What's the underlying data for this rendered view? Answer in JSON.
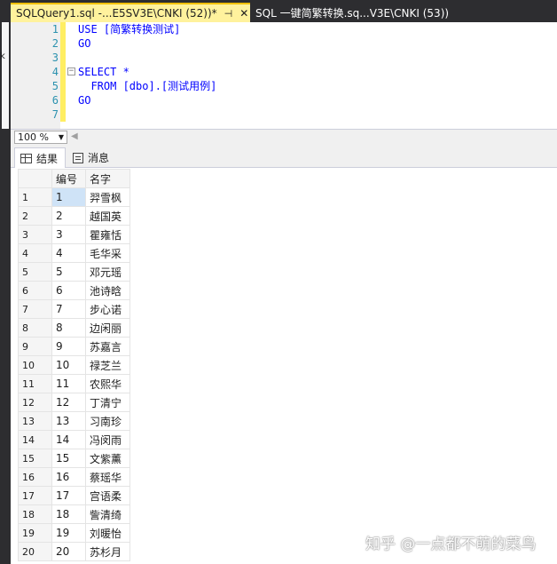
{
  "tabs": [
    {
      "label": "SQLQuery1.sql -...E5SV3E\\CNKI (52))*",
      "pin_icon": "pin-icon",
      "close_icon": "close-icon"
    },
    {
      "label": "SQL 一键简繁转换.sq...V3E\\CNKI (53))"
    }
  ],
  "editor": {
    "lines": [
      {
        "num": "1",
        "text": "USE [简繁转换测试]"
      },
      {
        "num": "2",
        "text": "GO"
      },
      {
        "num": "3",
        "text": ""
      },
      {
        "num": "4",
        "text": "SELECT *"
      },
      {
        "num": "5",
        "text": "  FROM [dbo].[测试用例]"
      },
      {
        "num": "6",
        "text": "GO"
      },
      {
        "num": "7",
        "text": ""
      }
    ]
  },
  "zoom": {
    "value": "100 %"
  },
  "result_tabs": [
    {
      "label": "结果",
      "icon": "grid-icon"
    },
    {
      "label": "消息",
      "icon": "message-icon"
    }
  ],
  "grid": {
    "columns": [
      "编号",
      "名字"
    ],
    "rows": [
      [
        "1",
        "1",
        "羿雪枫"
      ],
      [
        "2",
        "2",
        "越国英"
      ],
      [
        "3",
        "3",
        "瞿雍恬"
      ],
      [
        "4",
        "4",
        "毛华采"
      ],
      [
        "5",
        "5",
        "邓元瑶"
      ],
      [
        "6",
        "6",
        "池诗晗"
      ],
      [
        "7",
        "7",
        "步心诺"
      ],
      [
        "8",
        "8",
        "边闲丽"
      ],
      [
        "9",
        "9",
        "苏嘉言"
      ],
      [
        "10",
        "10",
        "禄芝兰"
      ],
      [
        "11",
        "11",
        "农熙华"
      ],
      [
        "12",
        "12",
        "丁清宁"
      ],
      [
        "13",
        "13",
        "习南珍"
      ],
      [
        "14",
        "14",
        "冯闵雨"
      ],
      [
        "15",
        "15",
        "文紫薰"
      ],
      [
        "16",
        "16",
        "蔡瑶华"
      ],
      [
        "17",
        "17",
        "宫语柔"
      ],
      [
        "18",
        "18",
        "訾清绮"
      ],
      [
        "19",
        "19",
        "刘暖怡"
      ],
      [
        "20",
        "20",
        "苏杉月"
      ]
    ]
  },
  "watermark": "知乎 @一点都不萌的菜鸟"
}
